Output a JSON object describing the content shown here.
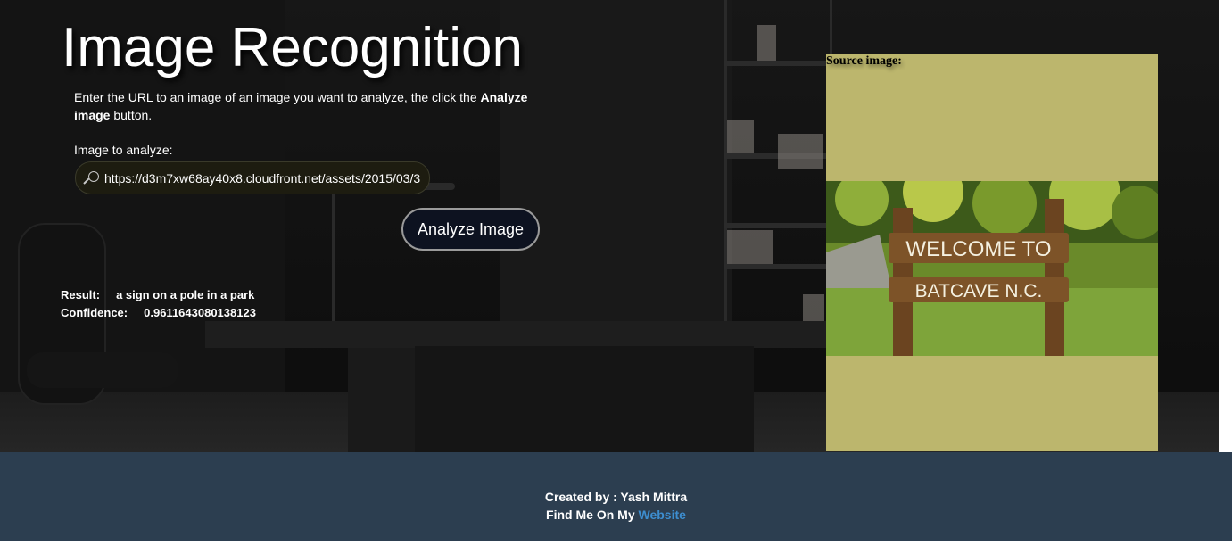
{
  "page": {
    "title": "Image Recognition",
    "intro_prefix": "Enter the URL to an image of an image you want to analyze, the click the ",
    "intro_bold": "Analyze image",
    "intro_suffix": " button.",
    "image_label": "Image to analyze:"
  },
  "form": {
    "url_value": "https://d3m7xw68ay40x8.cloudfront.net/assets/2015/03/3",
    "search_icon": "magnifier-icon",
    "analyze_button": "Analyze Image"
  },
  "result": {
    "result_label": "Result:",
    "result_value": "a sign on a pole in a park",
    "confidence_label": "Confidence:",
    "confidence_value": "0.9611643080138123"
  },
  "source": {
    "label": "Source image:",
    "sign_line1": "WELCOME TO",
    "sign_line2": "BATCAVE N.C."
  },
  "footer": {
    "created_by": "Created by : Yash Mittra",
    "find_me": "Find Me On My ",
    "website_link": "Website"
  },
  "colors": {
    "footer_bg": "#2c3e50",
    "link": "#3d8ed0",
    "source_panel_bg": "#bcb66d"
  }
}
